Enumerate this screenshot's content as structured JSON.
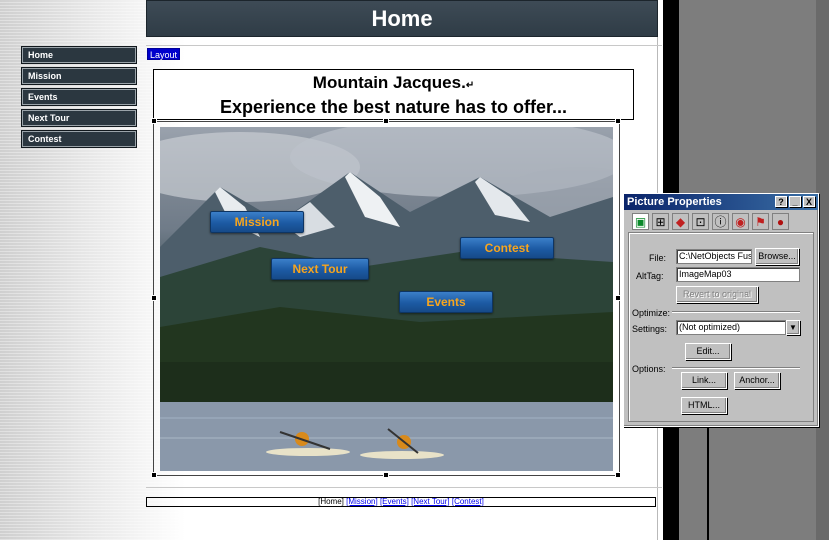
{
  "header": {
    "title": "Home"
  },
  "nav": {
    "items": [
      {
        "label": "Home"
      },
      {
        "label": "Mission"
      },
      {
        "label": "Events"
      },
      {
        "label": "Next Tour"
      },
      {
        "label": "Contest"
      }
    ]
  },
  "layout_tag": "Layout",
  "title_box": {
    "line1": "Mountain Jacques.",
    "return_glyph": "↵",
    "line2": "Experience the best nature has to offer..."
  },
  "hotspots": {
    "mission": "Mission",
    "next_tour": "Next Tour",
    "contest": "Contest",
    "events": "Events"
  },
  "bottom_nav": {
    "home": "[Home]",
    "mission": "[Mission]",
    "events": "[Events]",
    "next_tour": "[Next Tour]",
    "contest": "[Contest]"
  },
  "dialog": {
    "title": "Picture Properties",
    "help_btn": "?",
    "min_btn": "_",
    "close_btn": "X",
    "file_label": "File:",
    "file_value": "C:\\NetObjects Fusi",
    "browse_btn": "Browse...",
    "alt_label": "AltTag:",
    "alt_value": "ImageMap03",
    "revert_btn": "Revert to original",
    "optimize_label": "Optimize:",
    "settings_label": "Settings:",
    "settings_value": "(Not optimized)",
    "edit_btn": "Edit...",
    "options_label": "Options:",
    "link_btn": "Link...",
    "anchor_btn": "Anchor...",
    "html_btn": "HTML...",
    "tab_icons": [
      "picture-icon",
      "dash-picture-icon",
      "paint-icon",
      "frame-icon",
      "info-icon",
      "eye-icon",
      "flag-icon",
      "record-icon"
    ]
  }
}
